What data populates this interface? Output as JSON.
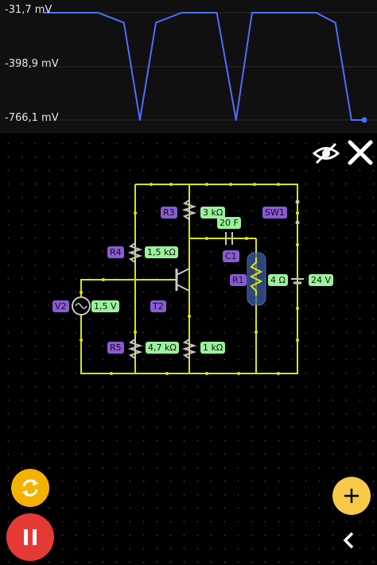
{
  "scope": {
    "labels": [
      "-31,7 mV",
      "-398,9 mV",
      "-766,1 mV"
    ],
    "trace_color": "#4d6fff",
    "trace": {
      "y_min": -766.1,
      "y_max": -31.7,
      "x": [
        0,
        0.17,
        0.25,
        0.3,
        0.35,
        0.43,
        0.54,
        0.6,
        0.65,
        0.72,
        0.85,
        0.91,
        0.96,
        1.0
      ],
      "y_mV": [
        -31.7,
        -31.7,
        -100,
        -766.1,
        -100,
        -31.7,
        -31.7,
        -766.1,
        -31.7,
        -31.7,
        -31.7,
        -100,
        -766.1,
        -766.1
      ]
    }
  },
  "toolbar": {
    "visibility_icon": "eye-slash-icon",
    "close_icon": "close-icon"
  },
  "components": [
    {
      "id": "r3",
      "name": "R3",
      "value": "3 kΩ"
    },
    {
      "id": "c1",
      "name": "C1",
      "value": "20 F"
    },
    {
      "id": "sw1",
      "name": "SW1",
      "value": ""
    },
    {
      "id": "r4",
      "name": "R4",
      "value": "1,5 kΩ"
    },
    {
      "id": "r1",
      "name": "R1",
      "value": "4 Ω"
    },
    {
      "id": "bat",
      "name": "",
      "value": "24 V"
    },
    {
      "id": "v2",
      "name": "V2",
      "value": "1,5 V"
    },
    {
      "id": "t2",
      "name": "T2",
      "value": ""
    },
    {
      "id": "r5",
      "name": "R5",
      "value": "4,7 kΩ"
    },
    {
      "id": "r6",
      "name": "",
      "value": "1 kΩ"
    }
  ],
  "colors": {
    "wire": "#d7e600",
    "component": "#c8c8c8",
    "resistor_current": "#e6e600",
    "name_tag": "#8a5bd6",
    "value_tag": "#9af29a",
    "reset_button": "#f4b200",
    "pause_button": "#e53935",
    "add_button": "#f7c948",
    "selection": "#3a5ea8"
  },
  "controls": {
    "reset_icon": "refresh-icon",
    "pause_icon": "pause-icon",
    "add_icon": "plus-icon",
    "back_icon": "chevron-left-icon"
  }
}
